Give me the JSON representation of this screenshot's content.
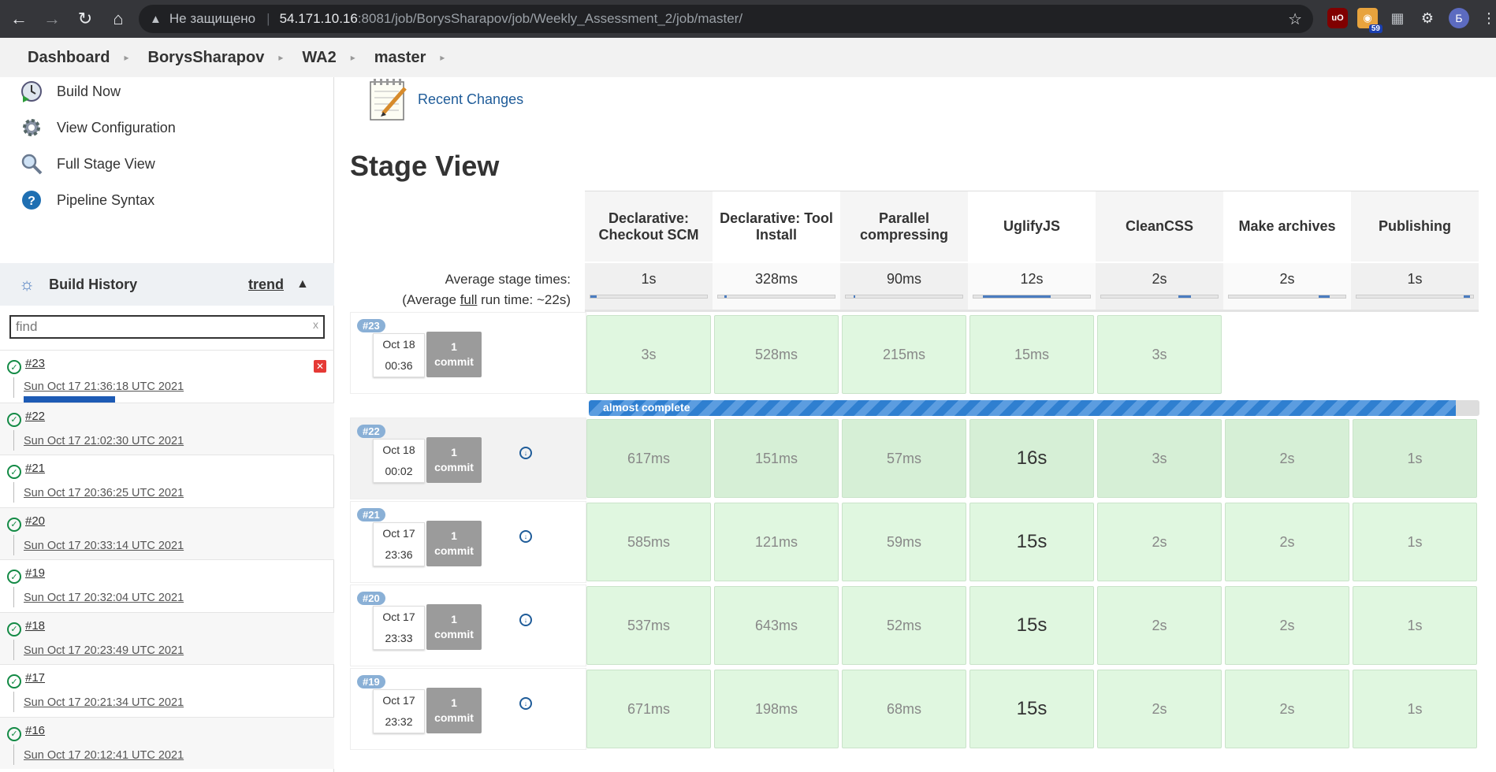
{
  "browser": {
    "insecure_label": "Не защищено",
    "url_host": "54.171.10.16",
    "url_path": ":8081/job/BorysSharapov/job/Weekly_Assessment_2/job/master/",
    "rss_badge": "59",
    "avatar_letter": "Б"
  },
  "breadcrumb": [
    "Dashboard",
    "BorysSharapov",
    "WA2",
    "master"
  ],
  "sidebar": {
    "tasks": [
      {
        "label": "Build Now",
        "icon": "clock-play-icon"
      },
      {
        "label": "View Configuration",
        "icon": "gear-icon"
      },
      {
        "label": "Full Stage View",
        "icon": "magnifier-icon"
      },
      {
        "label": "Pipeline Syntax",
        "icon": "help-icon"
      }
    ],
    "build_history_title": "Build History",
    "trend_label": "trend",
    "find_placeholder": "find",
    "builds": [
      {
        "num": "#23",
        "date": "Sun Oct 17 21:36:18 UTC 2021",
        "in_progress": true
      },
      {
        "num": "#22",
        "date": "Sun Oct 17 21:02:30 UTC 2021"
      },
      {
        "num": "#21",
        "date": "Sun Oct 17 20:36:25 UTC 2021"
      },
      {
        "num": "#20",
        "date": "Sun Oct 17 20:33:14 UTC 2021"
      },
      {
        "num": "#19",
        "date": "Sun Oct 17 20:32:04 UTC 2021"
      },
      {
        "num": "#18",
        "date": "Sun Oct 17 20:23:49 UTC 2021"
      },
      {
        "num": "#17",
        "date": "Sun Oct 17 20:21:34 UTC 2021"
      },
      {
        "num": "#16",
        "date": "Sun Oct 17 20:12:41 UTC 2021"
      }
    ]
  },
  "main": {
    "recent_changes": "Recent Changes",
    "stage_view_title": "Stage View",
    "avg_label_1": "Average stage times:",
    "avg_label_2_pre": "(Average ",
    "avg_label_2_link": "full",
    "avg_label_2_post": " run time: ~22s)",
    "stages": [
      {
        "name": "Declarative: Checkout SCM",
        "avg": "1s"
      },
      {
        "name": "Declarative: Tool Install",
        "avg": "328ms"
      },
      {
        "name": "Parallel compressing",
        "avg": "90ms"
      },
      {
        "name": "UglifyJS",
        "avg": "12s"
      },
      {
        "name": "CleanCSS",
        "avg": "2s"
      },
      {
        "name": "Make archives",
        "avg": "2s"
      },
      {
        "name": "Publishing",
        "avg": "1s"
      }
    ],
    "progress_label": "almost complete",
    "runs": [
      {
        "num": "#23",
        "date1": "Oct 18",
        "date2": "00:36",
        "commits": "1",
        "commit_word": "commit",
        "times": [
          "3s",
          "528ms",
          "215ms",
          "15ms",
          "3s",
          "",
          ""
        ]
      },
      {
        "num": "#22",
        "date1": "Oct 18",
        "date2": "00:02",
        "commits": "1",
        "commit_word": "commit",
        "times": [
          "617ms",
          "151ms",
          "57ms",
          "16s",
          "3s",
          "2s",
          "1s"
        ]
      },
      {
        "num": "#21",
        "date1": "Oct 17",
        "date2": "23:36",
        "commits": "1",
        "commit_word": "commit",
        "times": [
          "585ms",
          "121ms",
          "59ms",
          "15s",
          "2s",
          "2s",
          "1s"
        ]
      },
      {
        "num": "#20",
        "date1": "Oct 17",
        "date2": "23:33",
        "commits": "1",
        "commit_word": "commit",
        "times": [
          "537ms",
          "643ms",
          "52ms",
          "15s",
          "2s",
          "2s",
          "1s"
        ]
      },
      {
        "num": "#19",
        "date1": "Oct 17",
        "date2": "23:32",
        "commits": "1",
        "commit_word": "commit",
        "times": [
          "671ms",
          "198ms",
          "68ms",
          "15s",
          "2s",
          "2s",
          "1s"
        ]
      }
    ]
  }
}
